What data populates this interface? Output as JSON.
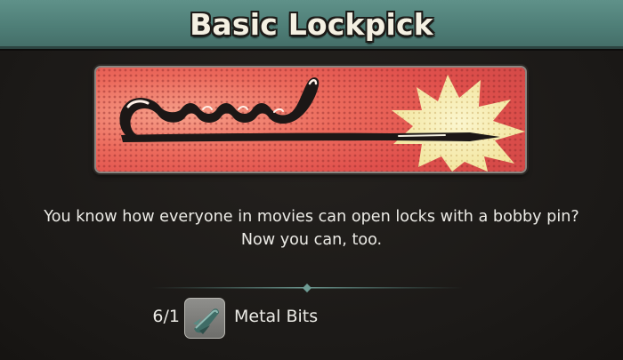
{
  "item": {
    "title": "Basic Lockpick",
    "description_line1": "You know how everyone in movies can open locks with a bobby pin?",
    "description_line2": "Now you can, too."
  },
  "cost": {
    "count": "6/1",
    "material_name": "Metal Bits",
    "material_icon": "metal-bits-icon"
  },
  "colors": {
    "title_bar": "#4f7f78",
    "banner_red": "#e2504c",
    "banner_cream": "#f6efb0",
    "text": "#ecebe6",
    "background": "#1d1b19"
  }
}
